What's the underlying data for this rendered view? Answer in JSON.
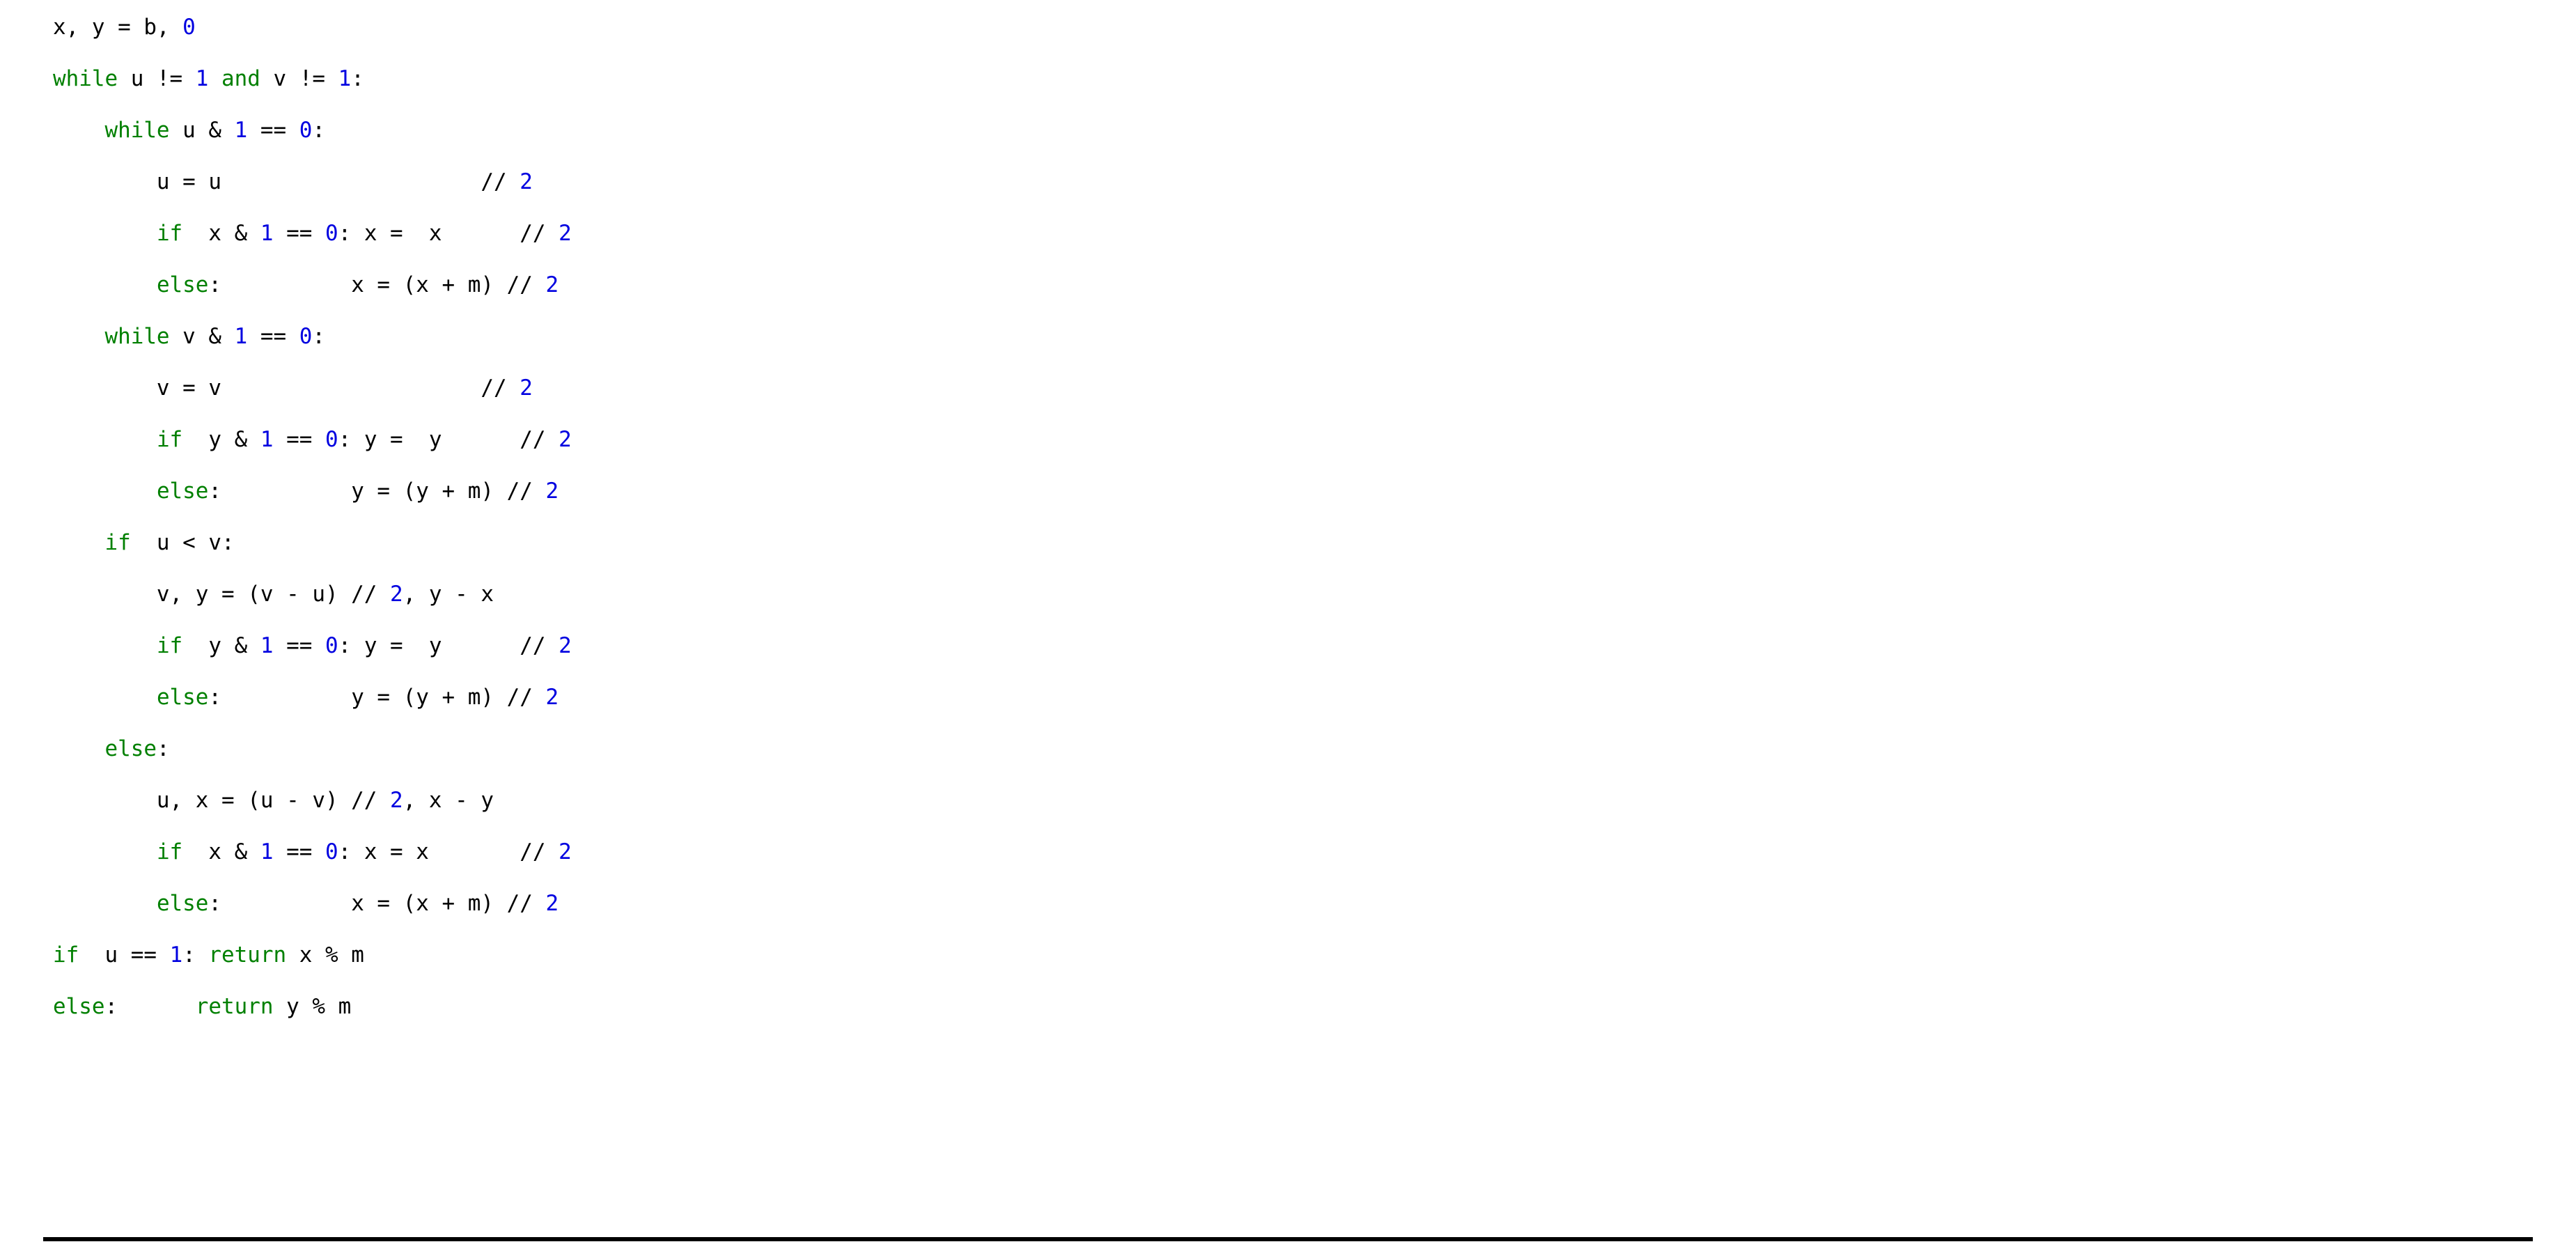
{
  "colors": {
    "keyword": "#008000",
    "number": "#0000E0",
    "plain": "#000000",
    "background": "#ffffff",
    "rule": "#000000"
  },
  "language": "python",
  "code_listing": {
    "line_count": 20,
    "lines": [
      [
        {
          "t": "x, y = b, ",
          "c": "pl"
        },
        {
          "t": "0",
          "c": "num"
        }
      ],
      [
        {
          "t": "while",
          "c": "kw"
        },
        {
          "t": " u != ",
          "c": "pl"
        },
        {
          "t": "1",
          "c": "num"
        },
        {
          "t": " ",
          "c": "pl"
        },
        {
          "t": "and",
          "c": "kw"
        },
        {
          "t": " v != ",
          "c": "pl"
        },
        {
          "t": "1",
          "c": "num"
        },
        {
          "t": ":",
          "c": "pl"
        }
      ],
      [
        {
          "t": "    ",
          "c": "pl"
        },
        {
          "t": "while",
          "c": "kw"
        },
        {
          "t": " u & ",
          "c": "pl"
        },
        {
          "t": "1",
          "c": "num"
        },
        {
          "t": " == ",
          "c": "pl"
        },
        {
          "t": "0",
          "c": "num"
        },
        {
          "t": ":",
          "c": "pl"
        }
      ],
      [
        {
          "t": "        u = u                    // ",
          "c": "pl"
        },
        {
          "t": "2",
          "c": "num"
        }
      ],
      [
        {
          "t": "        ",
          "c": "pl"
        },
        {
          "t": "if",
          "c": "kw"
        },
        {
          "t": "  x & ",
          "c": "pl"
        },
        {
          "t": "1",
          "c": "num"
        },
        {
          "t": " == ",
          "c": "pl"
        },
        {
          "t": "0",
          "c": "num"
        },
        {
          "t": ": x =  x      // ",
          "c": "pl"
        },
        {
          "t": "2",
          "c": "num"
        }
      ],
      [
        {
          "t": "        ",
          "c": "pl"
        },
        {
          "t": "else",
          "c": "kw"
        },
        {
          "t": ":          x = (x + m) // ",
          "c": "pl"
        },
        {
          "t": "2",
          "c": "num"
        }
      ],
      [
        {
          "t": "    ",
          "c": "pl"
        },
        {
          "t": "while",
          "c": "kw"
        },
        {
          "t": " v & ",
          "c": "pl"
        },
        {
          "t": "1",
          "c": "num"
        },
        {
          "t": " == ",
          "c": "pl"
        },
        {
          "t": "0",
          "c": "num"
        },
        {
          "t": ":",
          "c": "pl"
        }
      ],
      [
        {
          "t": "        v = v                    // ",
          "c": "pl"
        },
        {
          "t": "2",
          "c": "num"
        }
      ],
      [
        {
          "t": "        ",
          "c": "pl"
        },
        {
          "t": "if",
          "c": "kw"
        },
        {
          "t": "  y & ",
          "c": "pl"
        },
        {
          "t": "1",
          "c": "num"
        },
        {
          "t": " == ",
          "c": "pl"
        },
        {
          "t": "0",
          "c": "num"
        },
        {
          "t": ": y =  y      // ",
          "c": "pl"
        },
        {
          "t": "2",
          "c": "num"
        }
      ],
      [
        {
          "t": "        ",
          "c": "pl"
        },
        {
          "t": "else",
          "c": "kw"
        },
        {
          "t": ":          y = (y + m) // ",
          "c": "pl"
        },
        {
          "t": "2",
          "c": "num"
        }
      ],
      [
        {
          "t": "    ",
          "c": "pl"
        },
        {
          "t": "if",
          "c": "kw"
        },
        {
          "t": "  u < v:",
          "c": "pl"
        }
      ],
      [
        {
          "t": "        v, y = (v - u) // ",
          "c": "pl"
        },
        {
          "t": "2",
          "c": "num"
        },
        {
          "t": ", y - x",
          "c": "pl"
        }
      ],
      [
        {
          "t": "        ",
          "c": "pl"
        },
        {
          "t": "if",
          "c": "kw"
        },
        {
          "t": "  y & ",
          "c": "pl"
        },
        {
          "t": "1",
          "c": "num"
        },
        {
          "t": " == ",
          "c": "pl"
        },
        {
          "t": "0",
          "c": "num"
        },
        {
          "t": ": y =  y      // ",
          "c": "pl"
        },
        {
          "t": "2",
          "c": "num"
        }
      ],
      [
        {
          "t": "        ",
          "c": "pl"
        },
        {
          "t": "else",
          "c": "kw"
        },
        {
          "t": ":          y = (y + m) // ",
          "c": "pl"
        },
        {
          "t": "2",
          "c": "num"
        }
      ],
      [
        {
          "t": "    ",
          "c": "pl"
        },
        {
          "t": "else",
          "c": "kw"
        },
        {
          "t": ":",
          "c": "pl"
        }
      ],
      [
        {
          "t": "        u, x = (u - v) // ",
          "c": "pl"
        },
        {
          "t": "2",
          "c": "num"
        },
        {
          "t": ", x - y",
          "c": "pl"
        }
      ],
      [
        {
          "t": "        ",
          "c": "pl"
        },
        {
          "t": "if",
          "c": "kw"
        },
        {
          "t": "  x & ",
          "c": "pl"
        },
        {
          "t": "1",
          "c": "num"
        },
        {
          "t": " == ",
          "c": "pl"
        },
        {
          "t": "0",
          "c": "num"
        },
        {
          "t": ": x = x       // ",
          "c": "pl"
        },
        {
          "t": "2",
          "c": "num"
        }
      ],
      [
        {
          "t": "        ",
          "c": "pl"
        },
        {
          "t": "else",
          "c": "kw"
        },
        {
          "t": ":          x = (x + m) // ",
          "c": "pl"
        },
        {
          "t": "2",
          "c": "num"
        }
      ],
      [
        {
          "t": "if",
          "c": "kw"
        },
        {
          "t": "  u == ",
          "c": "pl"
        },
        {
          "t": "1",
          "c": "num"
        },
        {
          "t": ": ",
          "c": "pl"
        },
        {
          "t": "return",
          "c": "kw"
        },
        {
          "t": " x % m",
          "c": "pl"
        }
      ],
      [
        {
          "t": "else",
          "c": "kw"
        },
        {
          "t": ":      ",
          "c": "pl"
        },
        {
          "t": "return",
          "c": "kw"
        },
        {
          "t": " y % m",
          "c": "pl"
        }
      ]
    ],
    "plain_text": [
      "x, y = b, 0",
      "while u != 1 and v != 1:",
      "    while u & 1 == 0:",
      "        u = u                    // 2",
      "        if  x & 1 == 0: x =  x      // 2",
      "        else:          x = (x + m) // 2",
      "    while v & 1 == 0:",
      "        v = v                    // 2",
      "        if  y & 1 == 0: y =  y      // 2",
      "        else:          y = (y + m) // 2",
      "    if  u < v:",
      "        v, y = (v - u) // 2, y - x",
      "        if  y & 1 == 0: y =  y      // 2",
      "        else:          y = (y + m) // 2",
      "    else:",
      "        u, x = (u - v) // 2, x - y",
      "        if  x & 1 == 0: x = x       // 2",
      "        else:          x = (x + m) // 2",
      "if  u == 1: return x % m",
      "else:      return y % m"
    ],
    "keywords": [
      "while",
      "and",
      "if",
      "else",
      "return"
    ],
    "numeric_literals": [
      "0",
      "1",
      "2"
    ]
  }
}
